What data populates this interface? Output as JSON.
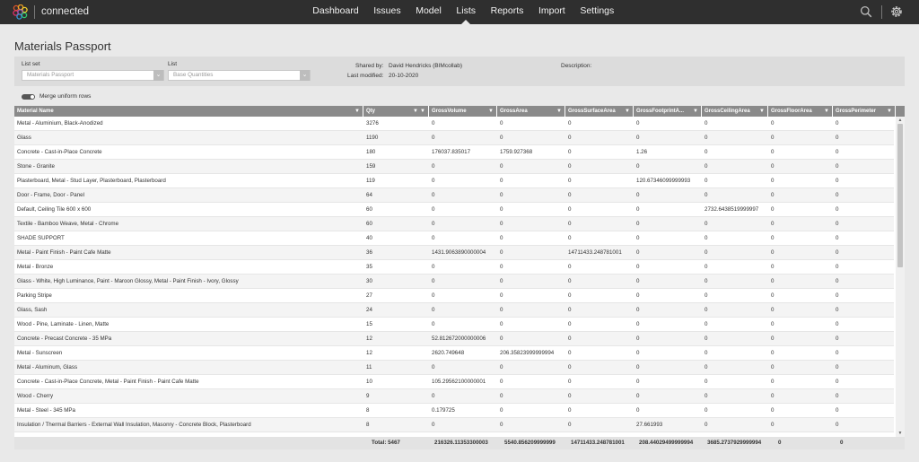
{
  "app": {
    "brand": "connected"
  },
  "nav": [
    {
      "label": "Dashboard",
      "active": false
    },
    {
      "label": "Issues",
      "active": false
    },
    {
      "label": "Model",
      "active": false
    },
    {
      "label": "Lists",
      "active": true
    },
    {
      "label": "Reports",
      "active": false
    },
    {
      "label": "Import",
      "active": false
    },
    {
      "label": "Settings",
      "active": false
    }
  ],
  "page": {
    "title": "Materials Passport"
  },
  "filters": {
    "list_set_label": "List set",
    "list_set_value": "Materials Passport",
    "list_label": "List",
    "list_value": "Base Quantities",
    "shared_by_label": "Shared by:",
    "shared_by_value": "David Hendricks (BIMcollab)",
    "last_modified_label": "Last modified:",
    "last_modified_value": "20-10-2020",
    "description_label": "Description:"
  },
  "merge_rows": {
    "label": "Merge uniform rows",
    "enabled": true
  },
  "table": {
    "columns": [
      "Material Name",
      "Qty",
      "GrossVolume",
      "GrossArea",
      "GrossSurfaceArea",
      "GrossFootprintA...",
      "GrossCeilingArea",
      "GrossFloorArea",
      "GrossPerimeter"
    ],
    "rows": [
      [
        "Metal - Aluminium, Black-Anodized",
        "3276",
        "0",
        "0",
        "0",
        "0",
        "0",
        "0",
        "0"
      ],
      [
        "Glass",
        "1190",
        "0",
        "0",
        "0",
        "0",
        "0",
        "0",
        "0"
      ],
      [
        "Concrete - Cast-in-Place Concrete",
        "180",
        "176037.835017",
        "1759.927368",
        "0",
        "1.26",
        "0",
        "0",
        "0"
      ],
      [
        "Stone - Granite",
        "159",
        "0",
        "0",
        "0",
        "0",
        "0",
        "0",
        "0"
      ],
      [
        "Plasterboard, Metal - Stud Layer, Plasterboard, Plasterboard",
        "119",
        "0",
        "0",
        "0",
        "120.67346099999993",
        "0",
        "0",
        "0"
      ],
      [
        "Door - Frame, Door - Panel",
        "64",
        "0",
        "0",
        "0",
        "0",
        "0",
        "0",
        "0"
      ],
      [
        "Default, Ceiling Tile 600 x 600",
        "60",
        "0",
        "0",
        "0",
        "0",
        "2732.6438519999997",
        "0",
        "0"
      ],
      [
        "Textile - Bamboo Weave, Metal - Chrome",
        "60",
        "0",
        "0",
        "0",
        "0",
        "0",
        "0",
        "0"
      ],
      [
        "SHADE SUPPORT",
        "40",
        "0",
        "0",
        "0",
        "0",
        "0",
        "0",
        "0"
      ],
      [
        "Metal - Paint Finish - Paint Cafe Matte",
        "36",
        "1431.9063890000004",
        "0",
        "14711433.248781001",
        "0",
        "0",
        "0",
        "0"
      ],
      [
        "Metal - Bronze",
        "35",
        "0",
        "0",
        "0",
        "0",
        "0",
        "0",
        "0"
      ],
      [
        "Glass - White, High Luminance, Paint - Maroon Glossy, Metal - Paint Finish - Ivory, Glossy",
        "30",
        "0",
        "0",
        "0",
        "0",
        "0",
        "0",
        "0"
      ],
      [
        "Parking Stripe",
        "27",
        "0",
        "0",
        "0",
        "0",
        "0",
        "0",
        "0"
      ],
      [
        "Glass, Sash",
        "24",
        "0",
        "0",
        "0",
        "0",
        "0",
        "0",
        "0"
      ],
      [
        "Wood - Pine, Laminate - Linen, Matte",
        "15",
        "0",
        "0",
        "0",
        "0",
        "0",
        "0",
        "0"
      ],
      [
        "Concrete - Precast Concrete - 35 MPa",
        "12",
        "52.812672000000006",
        "0",
        "0",
        "0",
        "0",
        "0",
        "0"
      ],
      [
        "Metal - Sunscreen",
        "12",
        "2620.749648",
        "206.35823999999994",
        "0",
        "0",
        "0",
        "0",
        "0"
      ],
      [
        "Metal - Aluminum, Glass",
        "11",
        "0",
        "0",
        "0",
        "0",
        "0",
        "0",
        "0"
      ],
      [
        "Concrete - Cast-in-Place Concrete, Metal - Paint Finish - Paint Cafe Matte",
        "10",
        "105.29562100000001",
        "0",
        "0",
        "0",
        "0",
        "0",
        "0"
      ],
      [
        "Wood - Cherry",
        "9",
        "0",
        "0",
        "0",
        "0",
        "0",
        "0",
        "0"
      ],
      [
        "Metal - Steel - 345 MPa",
        "8",
        "0.179725",
        "0",
        "0",
        "0",
        "0",
        "0",
        "0"
      ],
      [
        "Insulation / Thermal Barriers - External Wall Insulation, Masonry - Concrete Block, Plasterboard",
        "8",
        "0",
        "0",
        "0",
        "27.661993",
        "0",
        "0",
        "0"
      ]
    ],
    "totals": [
      "Total: 5467",
      "216326.11353300003",
      "5540.856209999999",
      "14711433.248781001",
      "208.44029499999994",
      "3685.2737929999994",
      "0",
      "0"
    ]
  }
}
